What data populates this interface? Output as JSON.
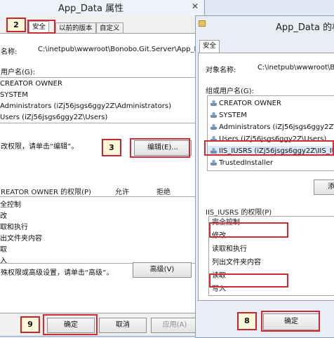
{
  "left_window": {
    "title": "App_Data 属性",
    "tabs": [
      "安全",
      "以前的版本",
      "自定义"
    ],
    "object_name_label": "名称:",
    "object_name_value": "C:\\inetpub\\wwwroot\\Bonobo.Git.Server\\App_Da",
    "group_label": "用户名(G):",
    "users": [
      "CREATOR OWNER",
      "SYSTEM",
      "Administrators (iZj56jsgs6ggy2Z\\Administrators)",
      "Users (iZj56jsgs6ggy2Z\\Users)"
    ],
    "change_hint": "改权限，请单击“编辑”。",
    "edit_button": "编辑(E)...",
    "perm_header": "REATOR OWNER 的权限(P)",
    "allow_header": "允许",
    "deny_header": "拒绝",
    "permissions": [
      "全控制",
      "改",
      "取和执行",
      "出文件夹内容",
      "取",
      "入"
    ],
    "advanced_hint": "殊权限或高级设置，请单击“高级”。",
    "advanced_button": "高级(V)",
    "ok_button": "确定",
    "cancel_button": "取消",
    "apply_button": "应用(A)"
  },
  "right_window": {
    "title": "App_Data 的权",
    "tab": "安全",
    "object_name_label": "对象名称:",
    "object_name_value": "C:\\inetpub\\wwwroot\\Bo",
    "group_label": "组或用户名(G):",
    "users": [
      "CREATOR OWNER",
      "SYSTEM",
      "Administrators (iZj56jsgs6ggy2Z\\Adr",
      "Users (iZj56jsgs6ggy2Z\\Users)",
      "IIS_IUSRS (iZj56jsgs6ggy2Z\\IIS_IUSR",
      "TrustedInstaller"
    ],
    "add_button": "添加",
    "perm_header": "IIS_IUSRS 的权限(P)",
    "permissions": [
      "完全控制",
      "修改",
      "读取和执行",
      "列出文件夹内容",
      "读取",
      "写入"
    ],
    "ok_button": "确定"
  },
  "steps": {
    "s2": "2",
    "s3": "3",
    "s8": "8",
    "s9": "9"
  },
  "colors": {
    "annotation_red": "#d22a32",
    "window_bg": "#f0f0f0"
  }
}
